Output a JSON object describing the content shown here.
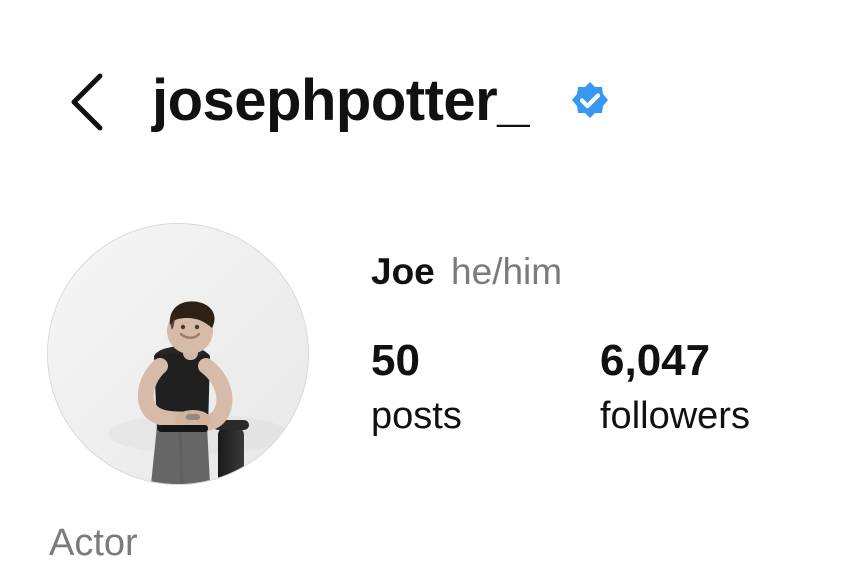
{
  "header": {
    "username": "josephpotter_",
    "verified": true,
    "back_icon": "chevron-left-icon",
    "verified_icon": "verified-badge-icon"
  },
  "profile": {
    "display_name": "Joe",
    "pronouns": "he/him",
    "avatar_alt": "profile photo",
    "stats": {
      "posts": {
        "count": "50",
        "label": "posts"
      },
      "followers": {
        "count": "6,047",
        "label": "followers"
      }
    },
    "category": "Actor"
  },
  "colors": {
    "text": "#111111",
    "muted": "#7b7b7b",
    "verified_blue": "#3897f0"
  }
}
